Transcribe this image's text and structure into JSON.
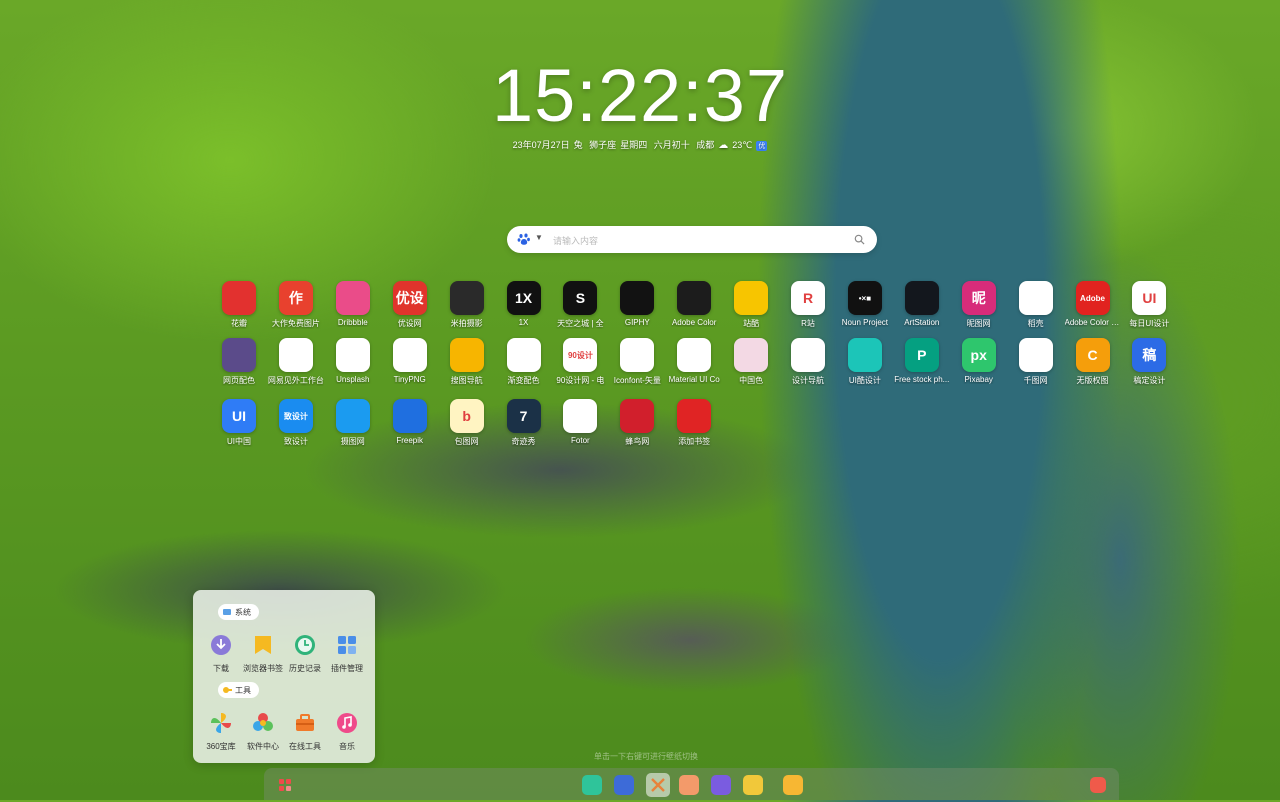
{
  "clock": {
    "time": "15:22:37"
  },
  "dateline": {
    "date": "23年07月27日",
    "zodiac": "兔",
    "constellation": "狮子座",
    "weekday": "星期四",
    "lunar": "六月初十",
    "city": "成都",
    "temperature": "23℃",
    "air_quality": "优"
  },
  "search": {
    "placeholder": "请输入内容"
  },
  "apps_row1": [
    {
      "label": "花瓣",
      "glyph": "",
      "bg": "#e2312f"
    },
    {
      "label": "大作免费图片",
      "glyph": "作",
      "bg": "#e8412e"
    },
    {
      "label": "Dribbble",
      "glyph": "",
      "bg": "#ea4c89"
    },
    {
      "label": "优设网",
      "glyph": "优设",
      "bg": "#e0342c"
    },
    {
      "label": "米拍摄影",
      "glyph": "",
      "bg": "#2a2a2a"
    },
    {
      "label": "1X",
      "glyph": "1X",
      "bg": "#111111"
    },
    {
      "label": "天空之城 | 全",
      "glyph": "S",
      "bg": "#111111"
    },
    {
      "label": "GIPHY",
      "glyph": "",
      "bg": "#121212"
    },
    {
      "label": "Adobe Color",
      "glyph": "",
      "bg": "#1c1c1c"
    },
    {
      "label": "站酷",
      "glyph": "",
      "bg": "#f7c500"
    },
    {
      "label": "R站",
      "glyph": "R",
      "bg": "#ffffff"
    },
    {
      "label": "Noun Project",
      "glyph": "•×■",
      "bg": "#111111"
    },
    {
      "label": "ArtStation",
      "glyph": "",
      "bg": "#13171d"
    },
    {
      "label": "昵图网",
      "glyph": "昵",
      "bg": "#d72c7a"
    },
    {
      "label": "稻壳",
      "glyph": "",
      "bg": "#ffffff"
    },
    {
      "label": "Adobe Color CC",
      "glyph": "Adobe",
      "bg": "#e1231f"
    },
    {
      "label": "每日UI设计",
      "glyph": "UI",
      "bg": "#ffffff"
    }
  ],
  "apps_row2": [
    {
      "label": "网页配色",
      "glyph": "",
      "bg": "#5b4b8a"
    },
    {
      "label": "网易见外工作台",
      "glyph": "",
      "bg": "#ffffff"
    },
    {
      "label": "Unsplash",
      "glyph": "",
      "bg": "#ffffff"
    },
    {
      "label": "TinyPNG",
      "glyph": "",
      "bg": "#ffffff"
    },
    {
      "label": "搜图导航",
      "glyph": "",
      "bg": "#f7b500"
    },
    {
      "label": "渐变配色",
      "glyph": "",
      "bg": "#ffffff"
    },
    {
      "label": "90设计网 - 电",
      "glyph": "90设计",
      "bg": "#ffffff"
    },
    {
      "label": "Iconfont-矢量",
      "glyph": "",
      "bg": "#ffffff"
    },
    {
      "label": "Material UI Co",
      "glyph": "",
      "bg": "#ffffff"
    },
    {
      "label": "中国色",
      "glyph": "",
      "bg": "#f3d9e4"
    },
    {
      "label": "设计导航",
      "glyph": "",
      "bg": "#ffffff"
    },
    {
      "label": "UI酷设计",
      "glyph": "",
      "bg": "#1cc5b8"
    },
    {
      "label": "Free stock ph...",
      "glyph": "P",
      "bg": "#05a081"
    },
    {
      "label": "Pixabay",
      "glyph": "px",
      "bg": "#2ec66d"
    },
    {
      "label": "千图网",
      "glyph": "",
      "bg": "#ffffff"
    },
    {
      "label": "无版权图",
      "glyph": "C",
      "bg": "#f59e0b"
    },
    {
      "label": "稿定设计",
      "glyph": "稿",
      "bg": "#2c6be6"
    }
  ],
  "apps_row3": [
    {
      "label": "UI中国",
      "glyph": "UI",
      "bg": "#2f7cf6"
    },
    {
      "label": "致设计",
      "glyph": "致设计",
      "bg": "#1a8cf0"
    },
    {
      "label": "摄图网",
      "glyph": "",
      "bg": "#1b9bf0"
    },
    {
      "label": "Freepik",
      "glyph": "",
      "bg": "#1f6fe0"
    },
    {
      "label": "包图网",
      "glyph": "b",
      "bg": "#fff4c2"
    },
    {
      "label": "奇迹秀",
      "glyph": "7",
      "bg": "#1b3147"
    },
    {
      "label": "Fotor",
      "glyph": "",
      "bg": "#ffffff"
    },
    {
      "label": "蜂鸟网",
      "glyph": "",
      "bg": "#d11f2c"
    },
    {
      "label": "添加书签",
      "glyph": "",
      "bg": "#e02424"
    }
  ],
  "panel": {
    "system_title": "系统",
    "system_items": [
      "下载",
      "浏览器书签",
      "历史记录",
      "插件管理"
    ],
    "tools_title": "工具",
    "tools_items": [
      "360宝库",
      "软件中心",
      "在线工具",
      "音乐"
    ]
  },
  "dock": {
    "hint": "单击一下右键可进行壁纸切换"
  }
}
